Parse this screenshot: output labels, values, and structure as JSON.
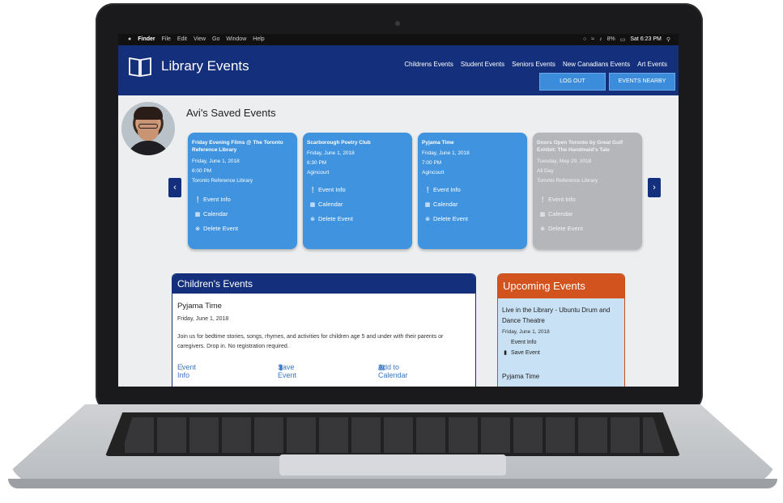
{
  "menubar": {
    "apple": "",
    "items": [
      "Finder",
      "File",
      "Edit",
      "View",
      "Go",
      "Window",
      "Help"
    ],
    "battery": "8%",
    "clock": "Sat 6:23 PM"
  },
  "header": {
    "title": "Library Events",
    "nav": [
      "Childrens Events",
      "Student Events",
      "Seniors Events",
      "New Canadians Events",
      "Art Events"
    ],
    "logout_label": "LOG OUT",
    "nearby_label": "EVENTS NEARBY"
  },
  "saved": {
    "title": "Avi's Saved Events",
    "action_labels": {
      "info": "Event Info",
      "calendar": "Calendar",
      "delete": "Delete Event"
    },
    "cards": [
      {
        "title": "Friday Evening Films @ The Toronto Reference Library",
        "date": "Friday, June 1, 2018",
        "time": "6:00 PM",
        "location": "Toronto Reference Library"
      },
      {
        "title": "Scarborough Poetry Club",
        "date": "Friday, June 1, 2018",
        "time": "6:30 PM",
        "location": "Agincourt"
      },
      {
        "title": "Pyjama Time",
        "date": "Friday, June 1, 2018",
        "time": "7:00 PM",
        "location": "Agincourt"
      },
      {
        "title": "Doors Open Toronto by Great Gulf Exhibit: The Handmaid's Tale",
        "date": "Tuesday, May 29, 2018",
        "time": "All Day",
        "location": "Toronto Reference Library"
      }
    ]
  },
  "children": {
    "heading": "Children's Events",
    "event_title": "Pyjama Time",
    "event_date": "Friday, June 1, 2018",
    "description": "Join us for bedtime stories, songs, rhymes, and activities for children age 5 and under with their parents or caregivers. Drop in. No registration required.",
    "link_info": "Event Info",
    "link_save": "Save Event",
    "link_calendar": "Add to Calendar"
  },
  "upcoming": {
    "heading": "Upcoming Events",
    "event1_title": "Live in the Library - Ubuntu Drum and Dance Theatre",
    "event1_date": "Friday, June 1, 2018",
    "link_info": "Event Info",
    "link_save": "Save Event",
    "event2_title": "Pyjama Time"
  },
  "icons": {
    "info": "info-circle-icon",
    "calendar": "calendar-icon",
    "delete": "times-circle-icon",
    "bookmark": "bookmark-icon",
    "prev": "chevron-left-icon",
    "next": "chevron-right-icon"
  },
  "colors": {
    "header_bg": "#14307d",
    "card_blue": "#3f93df",
    "card_gray": "#b4b6b9",
    "upcoming_header": "#d3531e",
    "upcoming_bg": "#c9e1f5",
    "link_blue": "#3b78c4"
  }
}
